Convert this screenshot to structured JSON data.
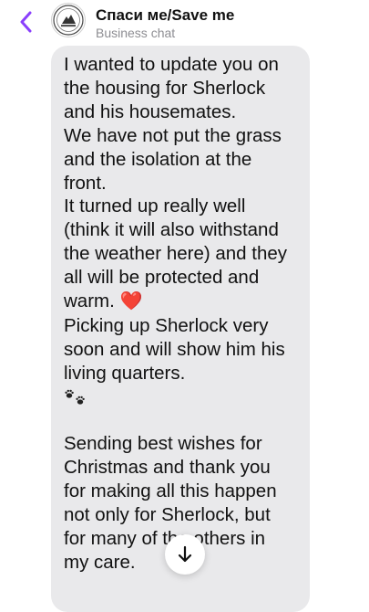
{
  "header": {
    "title": "Спаси ме/Save me",
    "subtitle": "Business chat"
  },
  "message": {
    "lines": [
      "I wanted to update you on",
      "the housing for Sherlock",
      "and his housemates.",
      "We have not put the grass",
      "and the isolation at the",
      "front.",
      "It turned up really well",
      "(think it will also withstand",
      "the weather here) and they",
      "all will be protected and",
      "warm.",
      "Picking up Sherlock very",
      "soon and will show him his",
      "living quarters.",
      "",
      "",
      "Sending best wishes for",
      "Christmas and thank you",
      "for making all this happen",
      "not only for Sherlock, but",
      "for many of the others in",
      "my care."
    ],
    "heart_emoji": "❤️"
  },
  "icons": {
    "back": "chevron-left-icon",
    "paws": "paw-prints-icon",
    "scroll": "arrow-down-icon"
  },
  "colors": {
    "accent": "#8a3ffc",
    "bubble": "#e9e9eb",
    "text": "#111111",
    "subtitle": "#8e8e93"
  }
}
